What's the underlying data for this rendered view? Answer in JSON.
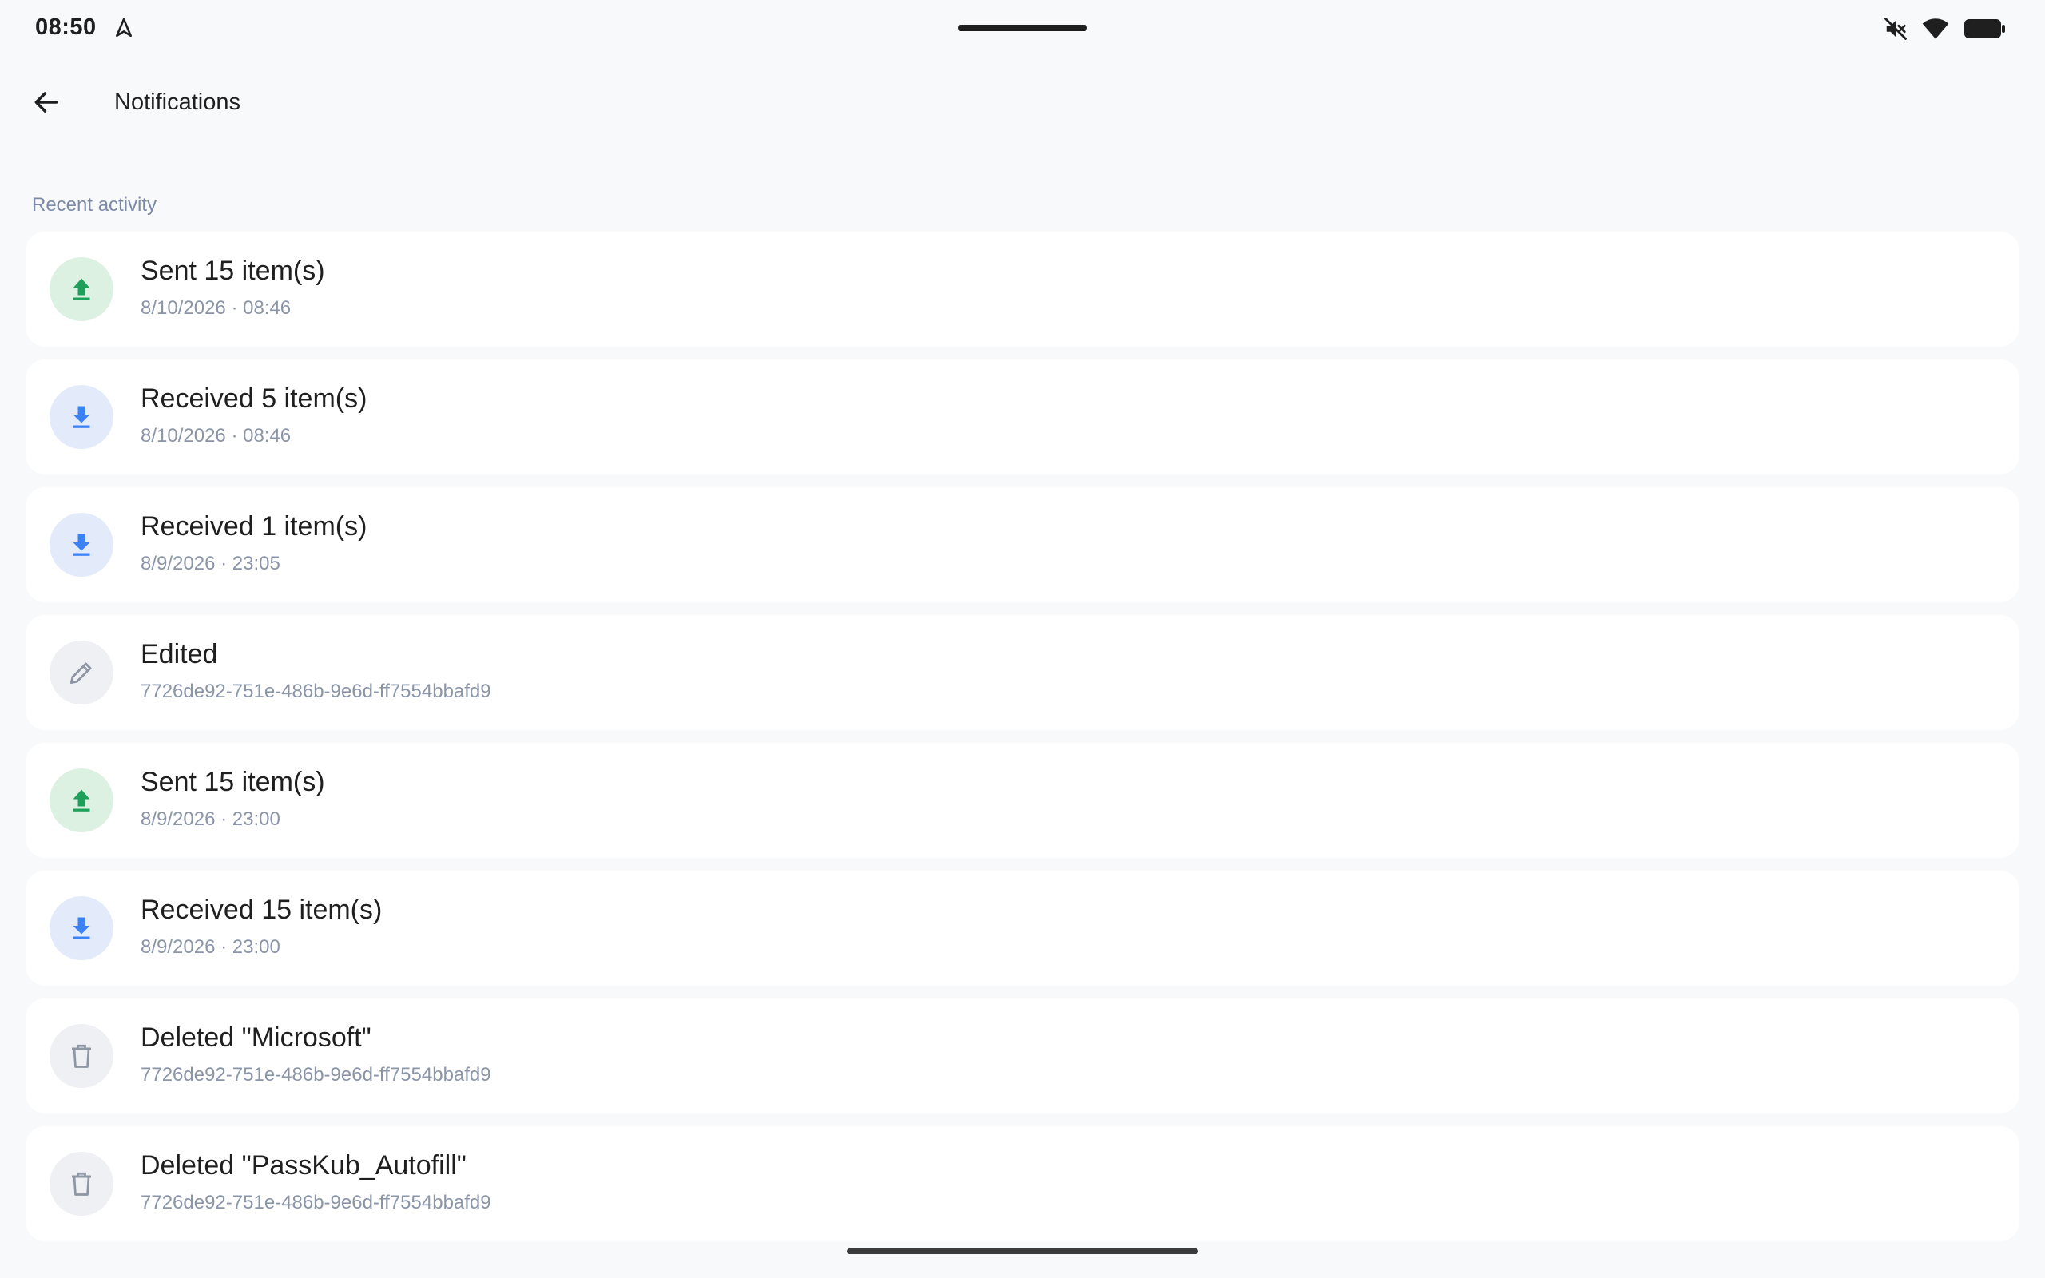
{
  "status_bar": {
    "time": "08:50",
    "icons": [
      "navigation-icon",
      "mute-icon",
      "wifi-icon",
      "battery-icon"
    ]
  },
  "app_bar": {
    "title": "Notifications",
    "back_icon": "arrow-left-icon"
  },
  "section": {
    "header": "Recent activity"
  },
  "colors": {
    "sent_accent": "#1ea05a",
    "sent_bg": "#dcf1e2",
    "received_accent": "#3b82f6",
    "received_bg": "#e3ebfb",
    "neutral_accent": "#8e96a3",
    "neutral_bg": "#eef0f3"
  },
  "notifications": [
    {
      "type": "sent",
      "icon": "upload-icon",
      "title": "Sent 15 item(s)",
      "subtitle": "8/10/2026 · 08:46"
    },
    {
      "type": "received",
      "icon": "download-icon",
      "title": "Received 5 item(s)",
      "subtitle": "8/10/2026 · 08:46"
    },
    {
      "type": "received",
      "icon": "download-icon",
      "title": "Received 1 item(s)",
      "subtitle": "8/9/2026 · 23:05"
    },
    {
      "type": "edited",
      "icon": "pencil-icon",
      "title": "Edited",
      "subtitle": "7726de92-751e-486b-9e6d-ff7554bbafd9"
    },
    {
      "type": "sent",
      "icon": "upload-icon",
      "title": "Sent 15 item(s)",
      "subtitle": "8/9/2026 · 23:00"
    },
    {
      "type": "received",
      "icon": "download-icon",
      "title": "Received 15 item(s)",
      "subtitle": "8/9/2026 · 23:00"
    },
    {
      "type": "deleted",
      "icon": "trash-icon",
      "title": "Deleted \"Microsoft\"",
      "subtitle": "7726de92-751e-486b-9e6d-ff7554bbafd9"
    },
    {
      "type": "deleted",
      "icon": "trash-icon",
      "title": "Deleted \"PassKub_Autofill\"",
      "subtitle": "7726de92-751e-486b-9e6d-ff7554bbafd9"
    }
  ]
}
